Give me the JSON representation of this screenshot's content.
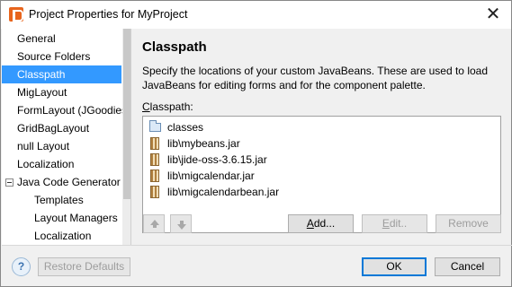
{
  "window": {
    "title": "Project Properties for MyProject",
    "close_glyph": "✕"
  },
  "sidebar": {
    "items": [
      {
        "label": "General"
      },
      {
        "label": "Source Folders"
      },
      {
        "label": "Classpath",
        "selected": true
      },
      {
        "label": "MigLayout"
      },
      {
        "label": "FormLayout (JGoodies)"
      },
      {
        "label": "GridBagLayout"
      },
      {
        "label": "null Layout"
      },
      {
        "label": "Localization"
      },
      {
        "label": "Java Code Generator",
        "expanded": true
      },
      {
        "label": "Templates"
      },
      {
        "label": "Layout Managers"
      },
      {
        "label": "Localization"
      }
    ]
  },
  "content": {
    "heading": "Classpath",
    "description": "Specify the locations of your custom JavaBeans. These are used to load JavaBeans for editing forms and for the component palette.",
    "classpath_label_mnemonic": "C",
    "classpath_label_rest": "lasspath:",
    "entries": [
      {
        "label": "classes",
        "icon": "folder-icon"
      },
      {
        "label": "lib\\mybeans.jar",
        "icon": "jar-icon"
      },
      {
        "label": "lib\\jide-oss-3.6.15.jar",
        "icon": "jar-icon"
      },
      {
        "label": "lib\\migcalendar.jar",
        "icon": "jar-icon"
      },
      {
        "label": "lib\\migcalendarbean.jar",
        "icon": "jar-icon"
      }
    ],
    "buttons": {
      "add_mnemonic": "A",
      "add_rest": "dd...",
      "edit_mnemonic": "E",
      "edit_rest": "dit..",
      "remove": "Remove"
    }
  },
  "footer": {
    "help": "?",
    "restore_defaults": "Restore Defaults",
    "ok": "OK",
    "cancel": "Cancel"
  },
  "colors": {
    "selection": "#3399ff",
    "default_button_border": "#0078d7"
  }
}
